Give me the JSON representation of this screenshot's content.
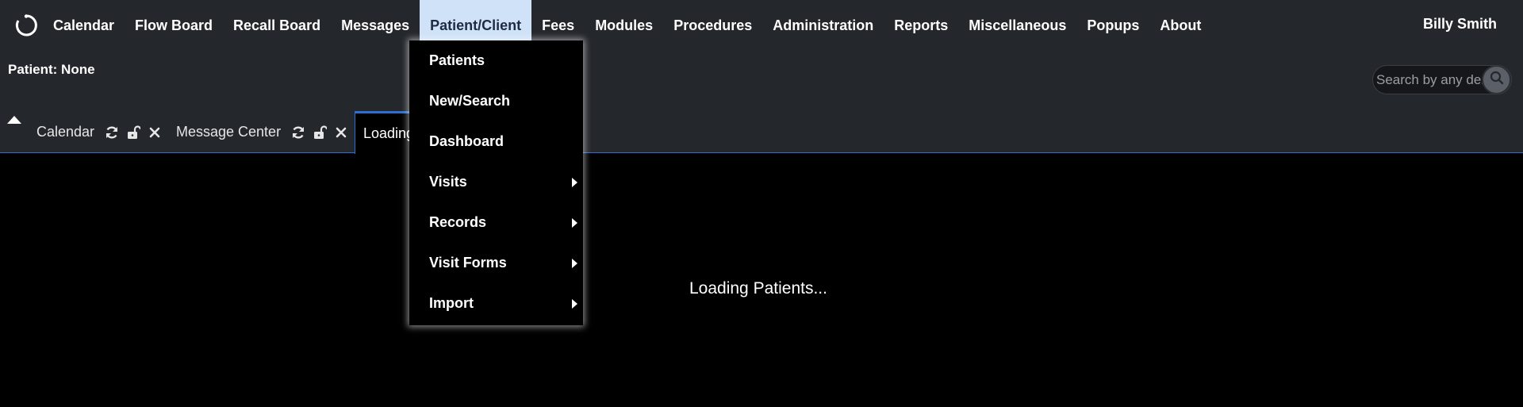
{
  "nav": {
    "logo_icon": "openemr-logo-icon",
    "items": [
      {
        "label": "Calendar"
      },
      {
        "label": "Flow Board"
      },
      {
        "label": "Recall Board"
      },
      {
        "label": "Messages"
      },
      {
        "label": "Patient/Client",
        "active": true
      },
      {
        "label": "Fees"
      },
      {
        "label": "Modules"
      },
      {
        "label": "Procedures"
      },
      {
        "label": "Administration"
      },
      {
        "label": "Reports"
      },
      {
        "label": "Miscellaneous"
      },
      {
        "label": "Popups"
      },
      {
        "label": "About"
      }
    ],
    "user": "Billy Smith"
  },
  "patient_bar": {
    "label": "Patient: None"
  },
  "search": {
    "placeholder": "Search by any demographics",
    "icon": "search-icon"
  },
  "tabs": [
    {
      "title": "Calendar",
      "icons": [
        "refresh-icon",
        "unlock-icon",
        "close-icon"
      ]
    },
    {
      "title": "Message Center",
      "icons": [
        "refresh-icon",
        "unlock-icon",
        "close-icon"
      ]
    },
    {
      "title": "Loading..."
    }
  ],
  "dropdown": {
    "items": [
      {
        "label": "Patients",
        "submenu": false
      },
      {
        "label": "New/Search",
        "submenu": false
      },
      {
        "label": "Dashboard",
        "submenu": false
      },
      {
        "label": "Visits",
        "submenu": true
      },
      {
        "label": "Records",
        "submenu": true
      },
      {
        "label": "Visit Forms",
        "submenu": true
      },
      {
        "label": "Import",
        "submenu": true
      }
    ]
  },
  "main": {
    "loading_text": "Loading Patients..."
  },
  "colors": {
    "topbar_bg": "#24272c",
    "active_menu_bg": "#cfe2f7",
    "accent_blue": "#2a6fd1",
    "content_bg": "#000000"
  }
}
